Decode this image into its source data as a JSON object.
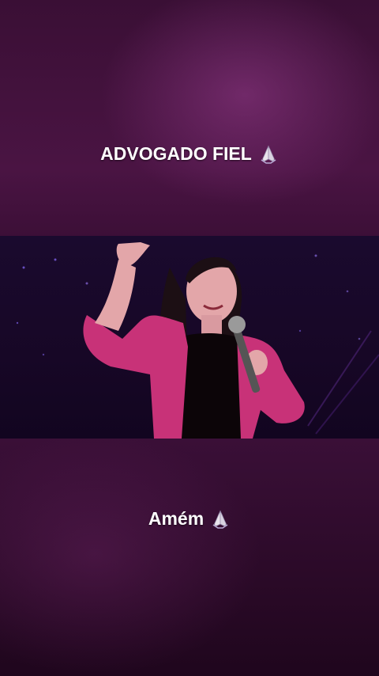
{
  "overlay": {
    "top_caption": "ADVOGADO FIEL",
    "top_emoji": "praying-hands-icon",
    "bottom_caption": "Amém",
    "bottom_emoji": "praying-hands-icon"
  },
  "colors": {
    "background": "#3a0f35",
    "video_background": "#1a0a2e",
    "blazer": "#c83278",
    "caption_text": "#ffffff"
  }
}
